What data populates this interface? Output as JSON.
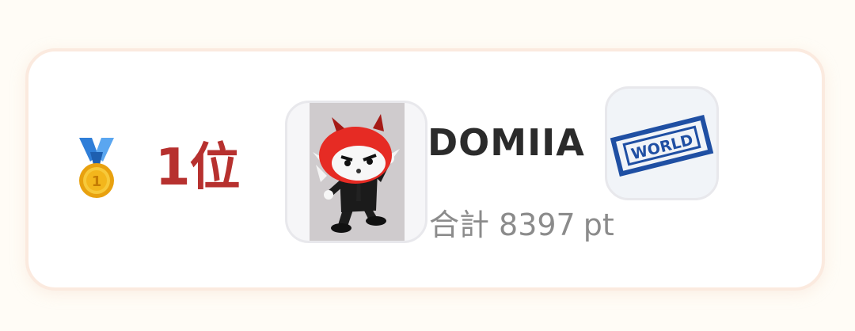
{
  "ranking_entry": {
    "medal_icon": "gold-medal-icon",
    "rank_label": "1位",
    "avatar_image": "mascot-photo",
    "name": "DOMIIA",
    "total_label": "合計",
    "points": "8397",
    "points_unit": "pt",
    "badge_icon": "world-stamp-icon",
    "badge_text": "WORLD"
  },
  "colors": {
    "rank_red": "#b7312f",
    "badge_blue": "#1f4fa3",
    "medal_gold": "#f3b61c",
    "ribbon_blue": "#2f7ed8"
  }
}
